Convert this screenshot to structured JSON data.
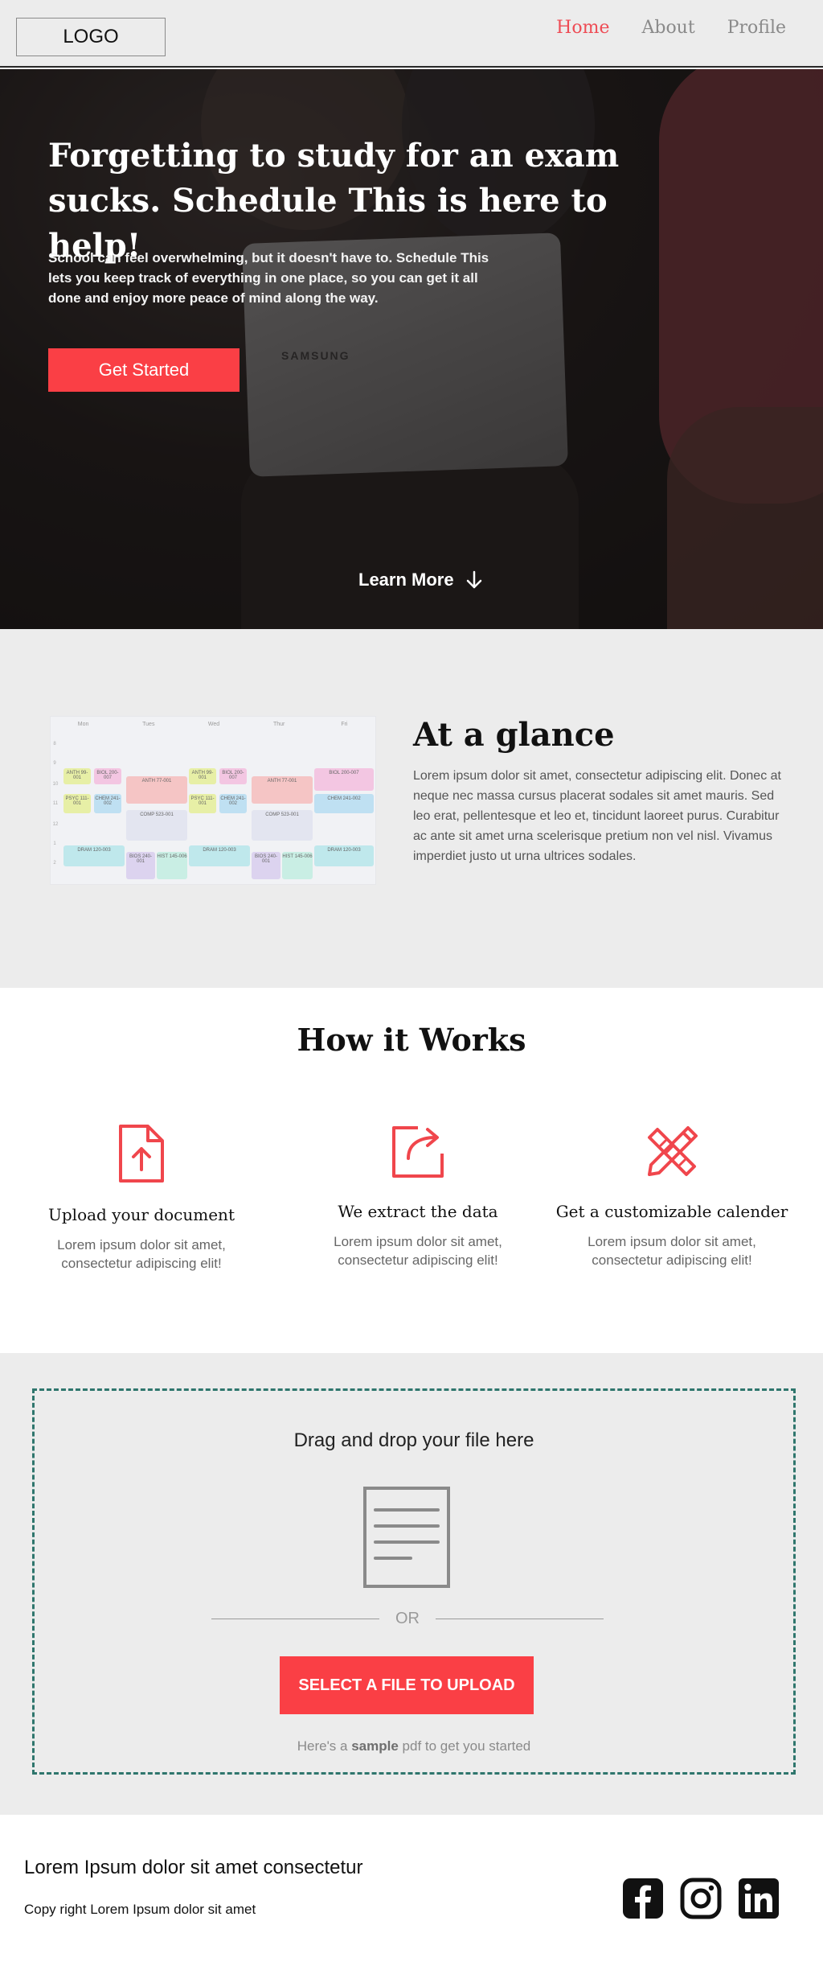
{
  "nav": {
    "logo": "LOGO",
    "links": [
      "Home",
      "About",
      "Profile"
    ],
    "active": "Home"
  },
  "hero": {
    "title": "Forgetting to study for an exam sucks. Schedule This is here to help!",
    "subtitle": "School can feel overwhelming, but it doesn't have to. Schedule This lets you keep track of everything in one place, so you can get it all done and enjoy more peace of mind along the way.",
    "cta": "Get Started",
    "learn_more": "Learn More",
    "laptop_brand": "SAMSUNG"
  },
  "glance": {
    "title": "At a glance",
    "text": "Lorem ipsum dolor sit amet, consectetur adipiscing elit. Donec at neque nec massa cursus placerat sodales sit amet mauris. Sed leo erat, pellentesque et leo et, tincidunt laoreet purus. Curabitur ac ante sit amet urna scelerisque pretium non vel nisl. Vivamus imperdiet justo ut urna ultrices sodales.",
    "calendar_days": [
      "Mon",
      "Tues",
      "Wed",
      "Thur",
      "Fri"
    ],
    "calendar_hours": [
      "8",
      "9",
      "10",
      "11",
      "12",
      "1",
      "2"
    ],
    "calendar_events": [
      "ANTH 99-001",
      "BIOL 200-007",
      "ANTH 77-001",
      "ANTH 99-001",
      "BIOL 200-007",
      "ANTH 77-001",
      "BIOL 200-007",
      "PSYC 111-001",
      "CHEM 241-002",
      "PSYC 111-001",
      "CHEM 241-002",
      "CHEM 241-002",
      "COMP 523-001",
      "COMP 523-001",
      "DRAM 120-003",
      "DRAM 120-003",
      "DRAM 120-003",
      "BIOS 240-001",
      "HIST 145-006",
      "BIOS 240-001",
      "HIST 145-006"
    ]
  },
  "how": {
    "title": "How it Works",
    "steps": [
      {
        "title": "Upload your document",
        "desc": "Lorem ipsum dolor sit amet, consectetur adipiscing elit!",
        "icon": "file-upload-icon"
      },
      {
        "title": "We extract the  data",
        "desc": "Lorem ipsum dolor sit amet, consectetur adipiscing elit!",
        "icon": "share-extract-icon"
      },
      {
        "title": "Get a customizable calender",
        "desc": "Lorem ipsum dolor sit amet, consectetur adipiscing elit!",
        "icon": "ruler-pencil-icon"
      }
    ]
  },
  "upload": {
    "title": "Drag and drop your file here",
    "or": "OR",
    "button": "SELECT A FILE TO UPLOAD",
    "sample_prefix": "Here's a ",
    "sample_link": "sample",
    "sample_suffix": " pdf to get you started"
  },
  "footer": {
    "title": "Lorem Ipsum dolor sit amet consectetur",
    "copyright": "Copy right Lorem Ipsum dolor sit amet",
    "socials": [
      "facebook-icon",
      "instagram-icon",
      "linkedin-icon"
    ]
  },
  "colors": {
    "accent": "#fa3f45",
    "nav_active": "#ee4c55",
    "dropzone_border": "#2f766d",
    "page_bg": "#ececec"
  }
}
